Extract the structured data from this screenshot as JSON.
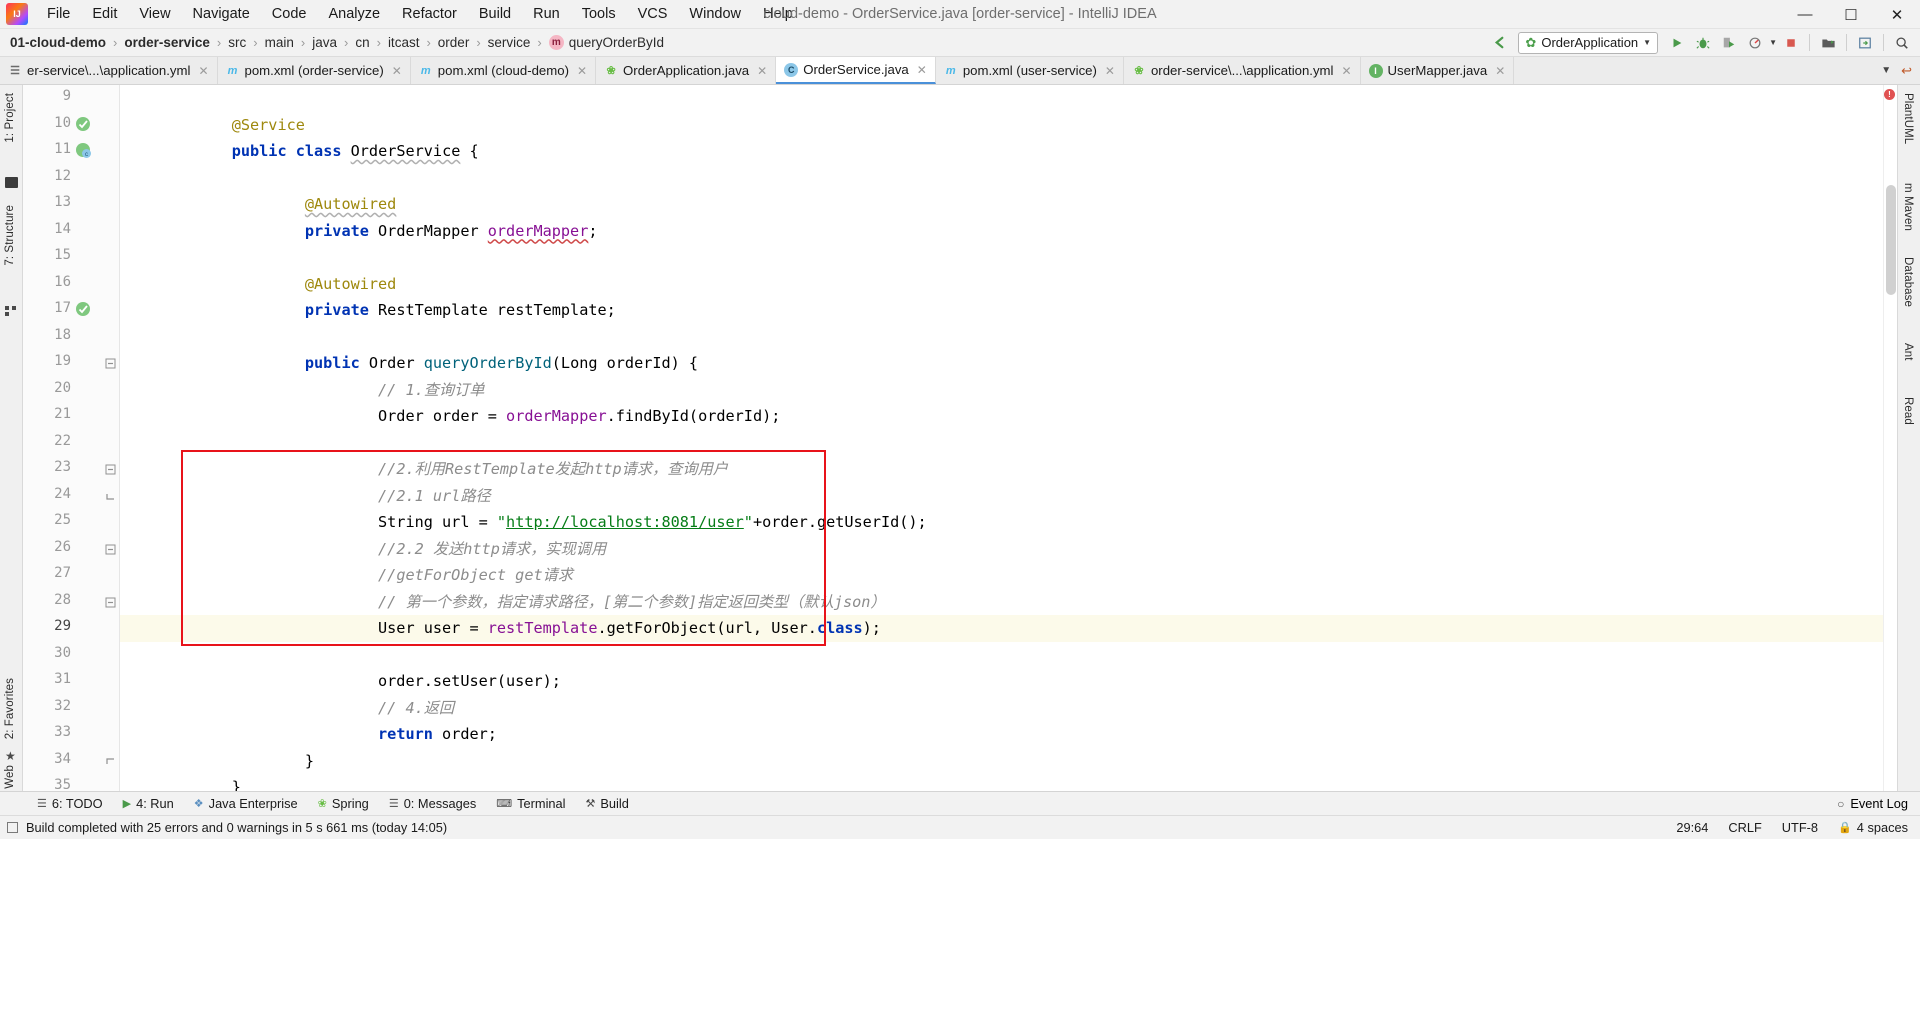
{
  "window": {
    "title": "cloud-demo - OrderService.java [order-service] - IntelliJ IDEA",
    "logo_icon": "intellij-idea-logo",
    "minimize_icon": "window-minimize-icon",
    "maximize_icon": "window-maximize-icon",
    "close_icon": "window-close-icon"
  },
  "menu": [
    {
      "label": "File"
    },
    {
      "label": "Edit"
    },
    {
      "label": "View"
    },
    {
      "label": "Navigate"
    },
    {
      "label": "Code"
    },
    {
      "label": "Analyze"
    },
    {
      "label": "Refactor"
    },
    {
      "label": "Build"
    },
    {
      "label": "Run"
    },
    {
      "label": "Tools"
    },
    {
      "label": "VCS"
    },
    {
      "label": "Window"
    },
    {
      "label": "Help"
    }
  ],
  "breadcrumb": {
    "separator": "›",
    "items": [
      {
        "label": "01-cloud-demo",
        "bold": true
      },
      {
        "label": "order-service",
        "bold": true
      },
      {
        "label": "src",
        "bold": false
      },
      {
        "label": "main",
        "bold": false
      },
      {
        "label": "java",
        "bold": false
      },
      {
        "label": "cn",
        "bold": false
      },
      {
        "label": "itcast",
        "bold": false
      },
      {
        "label": "order",
        "bold": false
      },
      {
        "label": "service",
        "bold": false
      },
      {
        "label": "queryOrderById",
        "bold": false,
        "badge": "m"
      }
    ]
  },
  "toolbar": {
    "back_icon": "back-arrow-icon",
    "run_config": "OrderApplication",
    "run_config_icon": "spring-leaf-icon",
    "dropdown_icon": "chevron-down-icon",
    "run_icon": "run-icon",
    "debug_icon": "debug-bug-icon",
    "coverage_icon": "run-with-coverage-icon",
    "profile_icon": "profiler-icon",
    "stop_icon": "stop-icon",
    "build_icon": "build-project-icon",
    "update_icon": "update-project-icon",
    "search_icon": "search-everywhere-icon"
  },
  "tabs": [
    {
      "label": "er-service\\...\\application.yml",
      "icon": "yaml-file-icon",
      "active": false,
      "closable": true
    },
    {
      "label": "pom.xml (order-service)",
      "icon": "maven-file-icon",
      "active": false,
      "closable": true
    },
    {
      "label": "pom.xml (cloud-demo)",
      "icon": "maven-file-icon",
      "active": false,
      "closable": true
    },
    {
      "label": "OrderApplication.java",
      "icon": "spring-class-icon",
      "active": false,
      "closable": true
    },
    {
      "label": "OrderService.java",
      "icon": "java-class-icon",
      "active": true,
      "closable": true
    },
    {
      "label": "pom.xml (user-service)",
      "icon": "maven-file-icon",
      "active": false,
      "closable": true
    },
    {
      "label": "order-service\\...\\application.yml",
      "icon": "spring-yaml-icon",
      "active": false,
      "closable": true
    },
    {
      "label": "UserMapper.java",
      "icon": "java-interface-icon",
      "active": true,
      "closable": true
    }
  ],
  "tabs_controls": {
    "overflow_icon": "chevron-down-icon",
    "restore_icon": "restore-layout-icon"
  },
  "left_toolwindows": [
    {
      "label": "1: Project",
      "icon": "project-icon"
    },
    {
      "label": "7: Structure",
      "icon": "structure-icon"
    },
    {
      "label": "2: Favorites",
      "icon": "favorites-star-icon"
    },
    {
      "label": "Web",
      "icon": "web-icon"
    }
  ],
  "right_toolwindows": [
    {
      "label": "PlantUML",
      "icon": "plantuml-icon"
    },
    {
      "label": "m Maven",
      "icon": "maven-icon"
    },
    {
      "label": "Database",
      "icon": "database-icon"
    },
    {
      "label": "Ant",
      "icon": "ant-icon"
    },
    {
      "label": "Read",
      "icon": "reader-icon"
    }
  ],
  "editor": {
    "first_line": 9,
    "caret_line": 29,
    "lines": [
      {
        "n": 9,
        "indent": 0,
        "tokens": [],
        "gutter": "",
        "fold": "",
        "highlight": false
      },
      {
        "n": 10,
        "indent": 0,
        "tokens": [
          {
            "t": "ann",
            "v": "@Service"
          }
        ],
        "gutter": "spring-bean-icon",
        "fold": "",
        "highlight": false
      },
      {
        "n": 11,
        "indent": 0,
        "tokens": [
          {
            "t": "kw",
            "v": "public"
          },
          {
            "t": "p",
            "v": " "
          },
          {
            "t": "kw",
            "v": "class"
          },
          {
            "t": "p",
            "v": " "
          },
          {
            "t": "wavy",
            "v": "OrderService"
          },
          {
            "t": "p",
            "v": " {"
          }
        ],
        "gutter": "spring-class-icon",
        "fold": "",
        "highlight": false
      },
      {
        "n": 12,
        "indent": 0,
        "tokens": [],
        "gutter": "",
        "fold": "",
        "highlight": false
      },
      {
        "n": 13,
        "indent": 1,
        "tokens": [
          {
            "t": "annwavy",
            "v": "@Autowired"
          }
        ],
        "gutter": "",
        "fold": "",
        "highlight": false
      },
      {
        "n": 14,
        "indent": 1,
        "tokens": [
          {
            "t": "kw",
            "v": "private"
          },
          {
            "t": "p",
            "v": " OrderMapper "
          },
          {
            "t": "fldwavy",
            "v": "orderMapper"
          },
          {
            "t": "p",
            "v": ";"
          }
        ],
        "gutter": "",
        "fold": "",
        "highlight": false
      },
      {
        "n": 15,
        "indent": 0,
        "tokens": [],
        "gutter": "",
        "fold": "",
        "highlight": false
      },
      {
        "n": 16,
        "indent": 1,
        "tokens": [
          {
            "t": "ann",
            "v": "@Autowired"
          }
        ],
        "gutter": "",
        "fold": "",
        "highlight": false
      },
      {
        "n": 17,
        "indent": 1,
        "tokens": [
          {
            "t": "kw",
            "v": "private"
          },
          {
            "t": "p",
            "v": " RestTemplate restTemplate;"
          }
        ],
        "gutter": "spring-bean-icon",
        "fold": "",
        "highlight": false
      },
      {
        "n": 18,
        "indent": 0,
        "tokens": [],
        "gutter": "",
        "fold": "",
        "highlight": false
      },
      {
        "n": 19,
        "indent": 1,
        "tokens": [
          {
            "t": "kw",
            "v": "public"
          },
          {
            "t": "p",
            "v": " Order "
          },
          {
            "t": "mth",
            "v": "queryOrderById"
          },
          {
            "t": "p",
            "v": "(Long orderId) {"
          }
        ],
        "gutter": "",
        "fold": "collapse",
        "highlight": false
      },
      {
        "n": 20,
        "indent": 2,
        "tokens": [
          {
            "t": "cmt",
            "v": "// 1.查询订单"
          }
        ],
        "gutter": "",
        "fold": "",
        "highlight": false
      },
      {
        "n": 21,
        "indent": 2,
        "tokens": [
          {
            "t": "p",
            "v": "Order order = "
          },
          {
            "t": "fld",
            "v": "orderMapper"
          },
          {
            "t": "p",
            "v": ".findById(orderId);"
          }
        ],
        "gutter": "",
        "fold": "",
        "highlight": false
      },
      {
        "n": 22,
        "indent": 0,
        "tokens": [],
        "gutter": "",
        "fold": "",
        "highlight": false
      },
      {
        "n": 23,
        "indent": 2,
        "tokens": [
          {
            "t": "cmt",
            "v": "//2.利用RestTemplate发起http请求，查询用户"
          }
        ],
        "gutter": "",
        "fold": "collapse",
        "highlight": false
      },
      {
        "n": 24,
        "indent": 2,
        "tokens": [
          {
            "t": "cmt",
            "v": "//2.1 url路径"
          }
        ],
        "gutter": "",
        "fold": "collapse2",
        "highlight": false
      },
      {
        "n": 25,
        "indent": 2,
        "tokens": [
          {
            "t": "p",
            "v": "String url = "
          },
          {
            "t": "str",
            "v": "\""
          },
          {
            "t": "strlink",
            "v": "http://localhost:8081/user"
          },
          {
            "t": "str",
            "v": "\""
          },
          {
            "t": "p",
            "v": "+order.getUserId();"
          }
        ],
        "gutter": "",
        "fold": "",
        "highlight": false
      },
      {
        "n": 26,
        "indent": 2,
        "tokens": [
          {
            "t": "cmt",
            "v": "//2.2 发送http请求，实现调用"
          }
        ],
        "gutter": "",
        "fold": "collapse",
        "highlight": false
      },
      {
        "n": 27,
        "indent": 2,
        "tokens": [
          {
            "t": "cmt",
            "v": "//getForObject get请求"
          }
        ],
        "gutter": "",
        "fold": "",
        "highlight": false
      },
      {
        "n": 28,
        "indent": 2,
        "tokens": [
          {
            "t": "cmt",
            "v": "// 第一个参数，指定请求路径，[第二个参数]指定返回类型（默认json）"
          }
        ],
        "gutter": "",
        "fold": "collapse",
        "highlight": false
      },
      {
        "n": 29,
        "indent": 2,
        "tokens": [
          {
            "t": "p",
            "v": "User user = "
          },
          {
            "t": "fld",
            "v": "restTemplate"
          },
          {
            "t": "p",
            "v": ".getForObject(url, User."
          },
          {
            "t": "kw",
            "v": "class"
          },
          {
            "t": "p",
            "v": ");"
          }
        ],
        "gutter": "",
        "fold": "",
        "highlight": true
      },
      {
        "n": 30,
        "indent": 0,
        "tokens": [],
        "gutter": "",
        "fold": "",
        "highlight": false
      },
      {
        "n": 31,
        "indent": 2,
        "tokens": [
          {
            "t": "p",
            "v": "order.setUser(user);"
          }
        ],
        "gutter": "",
        "fold": "",
        "highlight": false
      },
      {
        "n": 32,
        "indent": 2,
        "tokens": [
          {
            "t": "cmt",
            "v": "// 4.返回"
          }
        ],
        "gutter": "",
        "fold": "",
        "highlight": false
      },
      {
        "n": 33,
        "indent": 2,
        "tokens": [
          {
            "t": "kw",
            "v": "return"
          },
          {
            "t": "p",
            "v": " order;"
          }
        ],
        "gutter": "",
        "fold": "",
        "highlight": false
      },
      {
        "n": 34,
        "indent": 1,
        "tokens": [
          {
            "t": "p",
            "v": "}"
          }
        ],
        "gutter": "",
        "fold": "collapseEnd",
        "highlight": false
      },
      {
        "n": 35,
        "indent": 0,
        "tokens": [
          {
            "t": "p",
            "v": "}"
          }
        ],
        "gutter": "",
        "fold": "",
        "highlight": false
      }
    ],
    "annotation_box": {
      "color": "#e8131a",
      "from_line": 23,
      "to_line": 29
    }
  },
  "tool_windows_bar": [
    {
      "label": "6: TODO",
      "icon": "todo-icon"
    },
    {
      "label": "4: Run",
      "icon": "run-icon"
    },
    {
      "label": "Java Enterprise",
      "icon": "java-enterprise-icon"
    },
    {
      "label": "Spring",
      "icon": "spring-icon"
    },
    {
      "label": "0: Messages",
      "icon": "messages-icon"
    },
    {
      "label": "Terminal",
      "icon": "terminal-icon"
    },
    {
      "label": "Build",
      "icon": "build-icon"
    }
  ],
  "event_log": {
    "label": "Event Log",
    "icon": "event-log-icon"
  },
  "status": {
    "message": "Build completed with 25 errors and 0 warnings in 5 s 661 ms (today 14:05)",
    "caret_position": "29:64",
    "line_separator": "CRLF",
    "encoding": "UTF-8",
    "indent": "4 spaces",
    "lock_icon": "lock-icon"
  }
}
